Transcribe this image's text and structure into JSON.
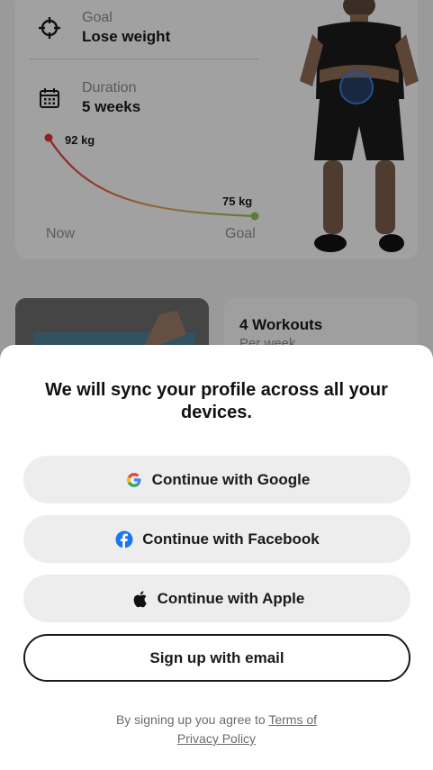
{
  "plan": {
    "goal_label": "Goal",
    "goal_value": "Lose weight",
    "duration_label": "Duration",
    "duration_value": "5 weeks",
    "start_weight": "92 kg",
    "target_weight": "75 kg",
    "axis_start": "Now",
    "axis_end": "Goal"
  },
  "workouts": {
    "title": "4 Workouts",
    "subtitle": "Per week"
  },
  "sheet": {
    "title": "We will sync your profile across all your devices.",
    "google_label": "Continue with Google",
    "facebook_label": "Continue with Facebook",
    "apple_label": "Continue with Apple",
    "email_label": "Sign up with email",
    "legal_prefix": "By signing up you agree to ",
    "terms_link": "Terms of",
    "privacy_link": "Privacy Policy"
  },
  "icons": {
    "goal": "target-icon",
    "duration": "calendar-icon",
    "google": "google-icon",
    "facebook": "facebook-icon",
    "apple": "apple-icon"
  },
  "colors": {
    "curve_start": "#d9343a",
    "curve_end": "#8bc34a",
    "facebook_blue": "#1877f2"
  }
}
